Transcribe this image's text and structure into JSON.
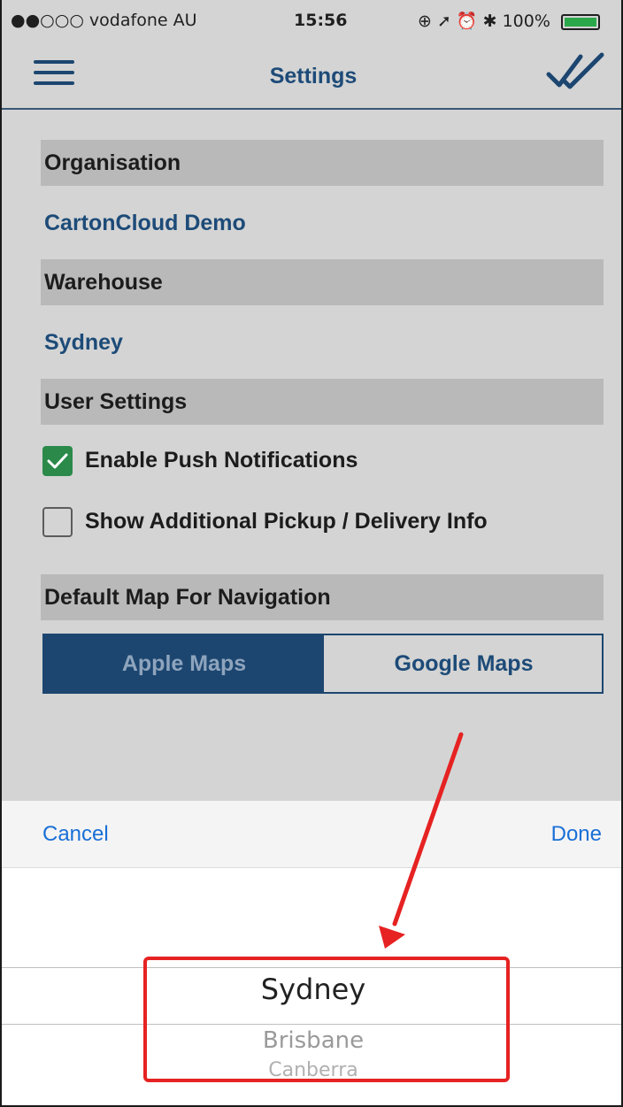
{
  "status_bar": {
    "carrier": "●●○○○ vodafone AU",
    "time": "15:56",
    "right_text": "⊕ ➚ ⏰ ✱ 100%"
  },
  "navbar": {
    "title": "Settings",
    "menu_icon": "hamburger-icon",
    "done_icon": "double-check-icon"
  },
  "settings": {
    "organisation_header": "Organisation",
    "organisation_value": "CartonCloud Demo",
    "warehouse_header": "Warehouse",
    "warehouse_value": "Sydney",
    "user_settings_header": "User Settings",
    "options": [
      {
        "label": "Enable Push Notifications",
        "checked": true
      },
      {
        "label": "Show Additional Pickup / Delivery Info",
        "checked": false
      }
    ],
    "default_map_header": "Default Map For Navigation",
    "map_options": [
      "Apple Maps",
      "Google Maps"
    ],
    "selected_map": "Apple Maps"
  },
  "picker": {
    "cancel_label": "Cancel",
    "done_label": "Done",
    "items": [
      "Sydney",
      "Brisbane",
      "Canberra"
    ],
    "selected": "Sydney"
  },
  "colors": {
    "brand": "#1c4670",
    "accent_blue": "#1a6fd6",
    "highlight": "#e62222",
    "check_green": "#2b8a4a"
  }
}
